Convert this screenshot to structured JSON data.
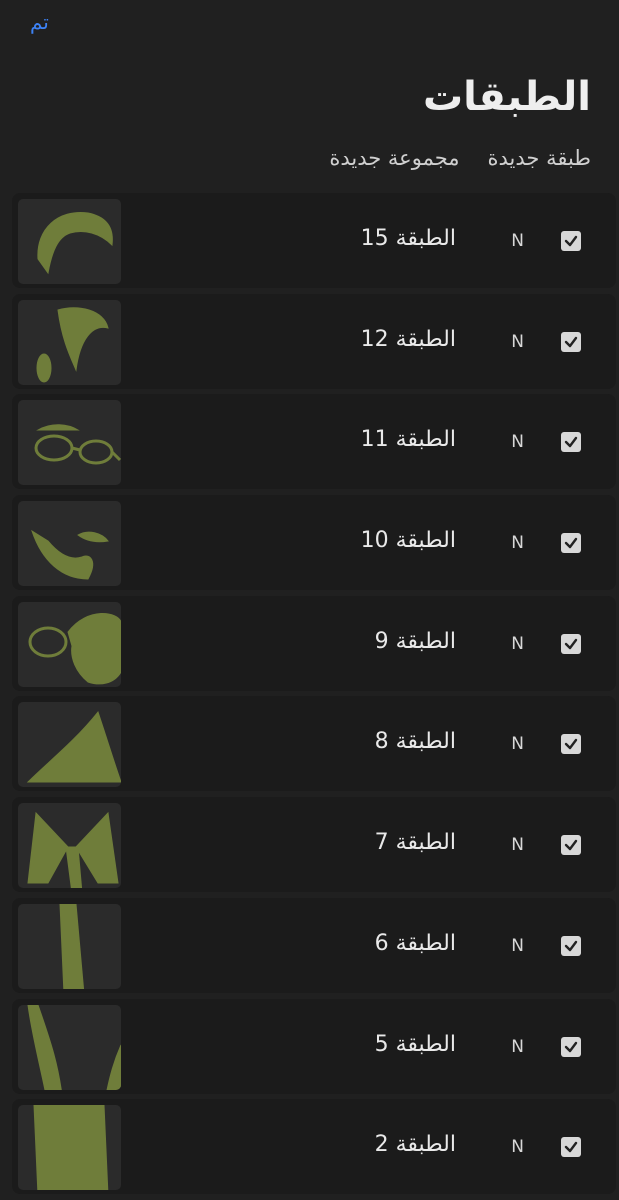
{
  "header": {
    "done_label": "تم",
    "title": "الطبقات",
    "new_layer_label": "طبقة جديدة",
    "new_group_label": "مجموعة جديدة"
  },
  "layers": [
    {
      "name": "الطبقة 15",
      "blend": "N",
      "visible": true,
      "thumb": "hair-icon"
    },
    {
      "name": "الطبقة 12",
      "blend": "N",
      "visible": true,
      "thumb": "hair-ear-icon"
    },
    {
      "name": "الطبقة 11",
      "blend": "N",
      "visible": true,
      "thumb": "glasses-icon"
    },
    {
      "name": "الطبقة 10",
      "blend": "N",
      "visible": true,
      "thumb": "beard-icon"
    },
    {
      "name": "الطبقة 9",
      "blend": "N",
      "visible": true,
      "thumb": "hand-glasses-icon"
    },
    {
      "name": "الطبقة 8",
      "blend": "N",
      "visible": true,
      "thumb": "lapel-icon"
    },
    {
      "name": "الطبقة 7",
      "blend": "N",
      "visible": true,
      "thumb": "collar-tie-icon"
    },
    {
      "name": "الطبقة 6",
      "blend": "N",
      "visible": true,
      "thumb": "tie-icon"
    },
    {
      "name": "الطبقة 5",
      "blend": "N",
      "visible": true,
      "thumb": "jacket-icon"
    },
    {
      "name": "الطبقة 2",
      "blend": "N",
      "visible": true,
      "thumb": "shirt-icon"
    }
  ],
  "colors": {
    "accent": "#3d82f5",
    "background": "#202020",
    "row": "#1b1b1b",
    "thumb_art": "#6f7d3a"
  }
}
